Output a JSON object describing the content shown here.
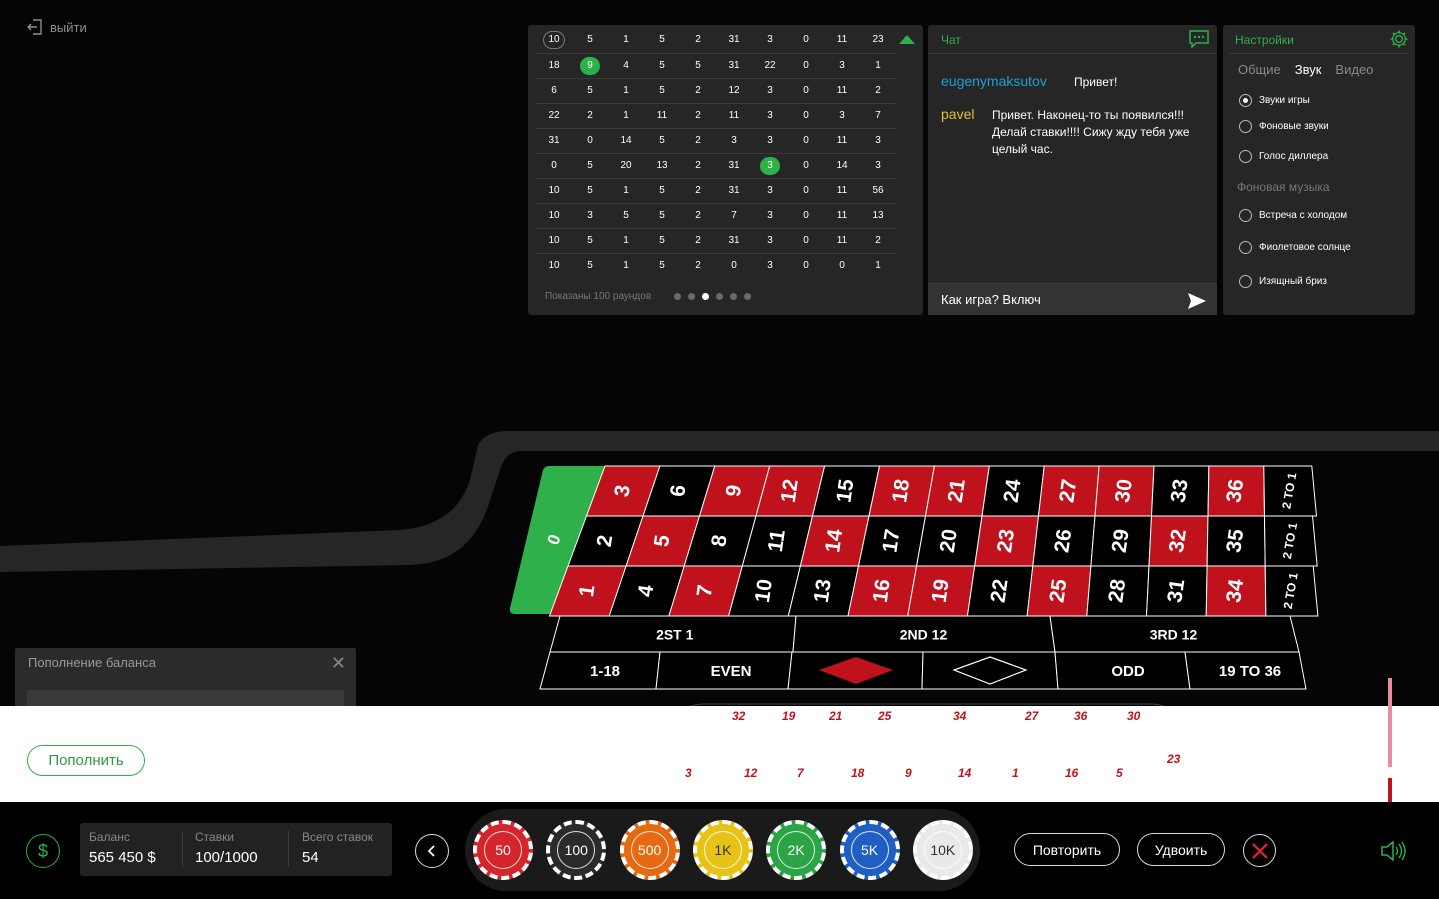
{
  "exit_label": "выйти",
  "history": {
    "rows": [
      [
        "10",
        "5",
        "1",
        "5",
        "2",
        "31",
        "3",
        "0",
        "11",
        "23"
      ],
      [
        "18",
        "9",
        "4",
        "5",
        "5",
        "31",
        "22",
        "0",
        "3",
        "1"
      ],
      [
        "6",
        "5",
        "1",
        "5",
        "2",
        "12",
        "3",
        "0",
        "11",
        "2"
      ],
      [
        "22",
        "2",
        "1",
        "11",
        "2",
        "11",
        "3",
        "0",
        "3",
        "7"
      ],
      [
        "31",
        "0",
        "14",
        "5",
        "2",
        "3",
        "3",
        "0",
        "11",
        "3"
      ],
      [
        "0",
        "5",
        "20",
        "13",
        "2",
        "31",
        "3",
        "0",
        "14",
        "3"
      ],
      [
        "10",
        "5",
        "1",
        "5",
        "2",
        "31",
        "3",
        "0",
        "11",
        "56"
      ],
      [
        "10",
        "3",
        "5",
        "5",
        "2",
        "7",
        "3",
        "0",
        "11",
        "13"
      ],
      [
        "10",
        "5",
        "1",
        "5",
        "2",
        "31",
        "3",
        "0",
        "11",
        "2"
      ],
      [
        "10",
        "5",
        "1",
        "5",
        "2",
        "0",
        "3",
        "0",
        "0",
        "1"
      ]
    ],
    "footer": "Показаны 100 раундов",
    "page_count": 6,
    "active_page": 3
  },
  "chat": {
    "title": "Чат",
    "messages": [
      {
        "user": "eugenymaksutov",
        "text": "Привет!"
      },
      {
        "user": "pavel",
        "text": "Привет. Наконец-то ты появился!!! Делай ставки!!!! Сижу жду тебя уже целый час."
      }
    ],
    "input_value": "Как игра? Включ"
  },
  "settings": {
    "title": "Настройки",
    "tabs": [
      "Общие",
      "Звук",
      "Видео"
    ],
    "active_tab": "Звук",
    "options": [
      {
        "label": "Звуки игры",
        "selected": true
      },
      {
        "label": "Фоновые звуки",
        "selected": false
      },
      {
        "label": "Голос диллера",
        "selected": false
      }
    ],
    "music_heading": "Фоновая музыка",
    "music": [
      {
        "label": "Встреча с холодом",
        "selected": false
      },
      {
        "label": "Фиолетовое солнце",
        "selected": false
      },
      {
        "label": "Изящный бриз",
        "selected": false
      }
    ]
  },
  "roulette": {
    "zero": "0",
    "cols_row1": [
      "3",
      "6",
      "9",
      "12",
      "15",
      "18",
      "21",
      "24",
      "27",
      "30",
      "33",
      "36"
    ],
    "cols_row2": [
      "2",
      "5",
      "8",
      "11",
      "14",
      "17",
      "20",
      "23",
      "26",
      "29",
      "32",
      "35"
    ],
    "cols_row3": [
      "1",
      "4",
      "7",
      "10",
      "13",
      "16",
      "19",
      "22",
      "25",
      "28",
      "31",
      "34"
    ],
    "red": [
      "1",
      "3",
      "5",
      "7",
      "9",
      "12",
      "14",
      "16",
      "18",
      "19",
      "21",
      "23",
      "25",
      "27",
      "30",
      "32",
      "34",
      "36"
    ],
    "column_bet": "2 TO 1",
    "dozens": [
      "2ST 1",
      "2ND 12",
      "3RD 12"
    ],
    "outside": [
      "1-18",
      "EVEN",
      "ODD",
      "19 TO 36"
    ]
  },
  "balance_panel": {
    "title": "Пополнение баланса"
  },
  "deposit_button": "Пополнить",
  "racetrack_top": [
    "32",
    "19",
    "21",
    "25",
    "34",
    "27",
    "36",
    "30"
  ],
  "racetrack_bottom": [
    "3",
    "12",
    "7",
    "18",
    "9",
    "14",
    "1",
    "16",
    "5"
  ],
  "racetrack_side": "23",
  "stats": {
    "balance_label": "Баланс",
    "balance_value": "565 450 $",
    "bets_label": "Ставки",
    "bets_value": "100/1000",
    "total_label": "Всего ставок",
    "total_value": "54"
  },
  "chips": [
    {
      "label": "50",
      "color": "#d4242c"
    },
    {
      "label": "100",
      "color": "#2b2b2b"
    },
    {
      "label": "500",
      "color": "#e56a12"
    },
    {
      "label": "1K",
      "color": "#e6c316"
    },
    {
      "label": "2K",
      "color": "#2aa444"
    },
    {
      "label": "5K",
      "color": "#1f5fc4"
    },
    {
      "label": "10K",
      "color": "#e9e9e9"
    }
  ],
  "repeat_button": "Повторить",
  "double_button": "Удвоить",
  "colors": {
    "accent": "#2eb04b",
    "red": "#c0121c",
    "cyan": "#1aa3d7"
  }
}
